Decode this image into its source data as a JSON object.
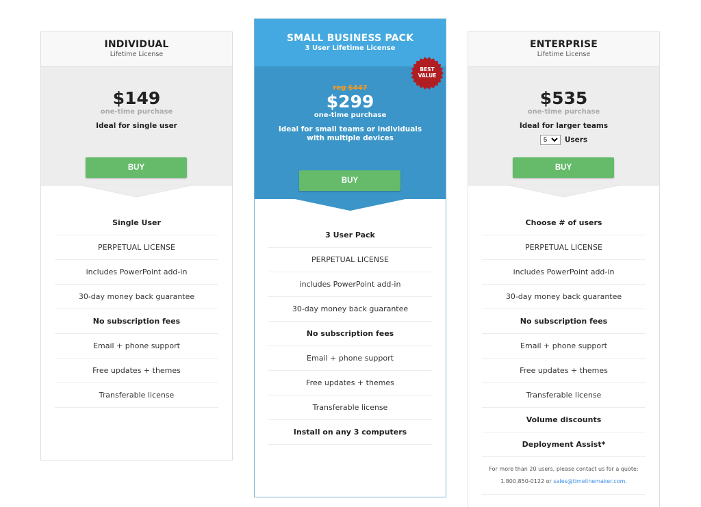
{
  "colors": {
    "buy_button": "#65bb6a",
    "business_header": "#44a9e0",
    "business_body": "#3b95c8",
    "badge": "#b01e22",
    "reg_price": "#f59a23",
    "link": "#3a8ee6"
  },
  "individual": {
    "title": "INDIVIDUAL",
    "subtitle": "Lifetime License",
    "price": "$149",
    "price_note": "one-time purchase",
    "ideal": "Ideal for single user",
    "buy_label": "BUY",
    "features": [
      {
        "text": "Single User",
        "bold": true
      },
      {
        "text": "PERPETUAL LICENSE",
        "bold": false
      },
      {
        "text": "includes PowerPoint add-in",
        "bold": false
      },
      {
        "text": "30-day money back guarantee",
        "bold": false
      },
      {
        "text": "No subscription fees",
        "bold": true
      },
      {
        "text": "Email + phone support",
        "bold": false
      },
      {
        "text": "Free updates + themes",
        "bold": false
      },
      {
        "text": "Transferable license",
        "bold": false
      }
    ]
  },
  "business": {
    "title": "SMALL BUSINESS PACK",
    "subtitle": "3 User Lifetime License",
    "badge": "BEST VALUE",
    "badge_line1": "BEST",
    "badge_line2": "VALUE",
    "reg_price": "reg $447",
    "price": "$299",
    "price_note": "one-time purchase",
    "ideal": "Ideal for small teams or individuals with multiple devices",
    "buy_label": "BUY",
    "features": [
      {
        "text": "3 User Pack",
        "bold": true
      },
      {
        "text": "PERPETUAL LICENSE",
        "bold": false
      },
      {
        "text": "includes PowerPoint add-in",
        "bold": false
      },
      {
        "text": "30-day money back guarantee",
        "bold": false
      },
      {
        "text": "No subscription fees",
        "bold": true
      },
      {
        "text": "Email + phone support",
        "bold": false
      },
      {
        "text": "Free updates + themes",
        "bold": false
      },
      {
        "text": "Transferable license",
        "bold": false
      },
      {
        "text": "Install on any 3 computers",
        "bold": true
      }
    ]
  },
  "enterprise": {
    "title": "ENTERPRISE",
    "subtitle": "Lifetime License",
    "price": "$535",
    "price_note": "one-time purchase",
    "ideal": "Ideal for larger teams",
    "users_select_value": "5",
    "users_label": "Users",
    "buy_label": "BUY",
    "features": [
      {
        "text": "Choose # of users",
        "bold": true
      },
      {
        "text": "PERPETUAL LICENSE",
        "bold": false
      },
      {
        "text": "includes PowerPoint add-in",
        "bold": false
      },
      {
        "text": "30-day money back guarantee",
        "bold": false
      },
      {
        "text": "No subscription fees",
        "bold": true
      },
      {
        "text": "Email + phone support",
        "bold": false
      },
      {
        "text": "Free updates + themes",
        "bold": false
      },
      {
        "text": "Transferable license",
        "bold": false
      },
      {
        "text": "Volume discounts",
        "bold": true
      },
      {
        "text": "Deployment Assist*",
        "bold": true
      }
    ],
    "quote_text": "For more than 20 users, please contact us for a quote:",
    "quote_phone": "1.800.850-0122 or ",
    "quote_email": "sales@timelinemaker.com",
    "quote_end": "."
  }
}
